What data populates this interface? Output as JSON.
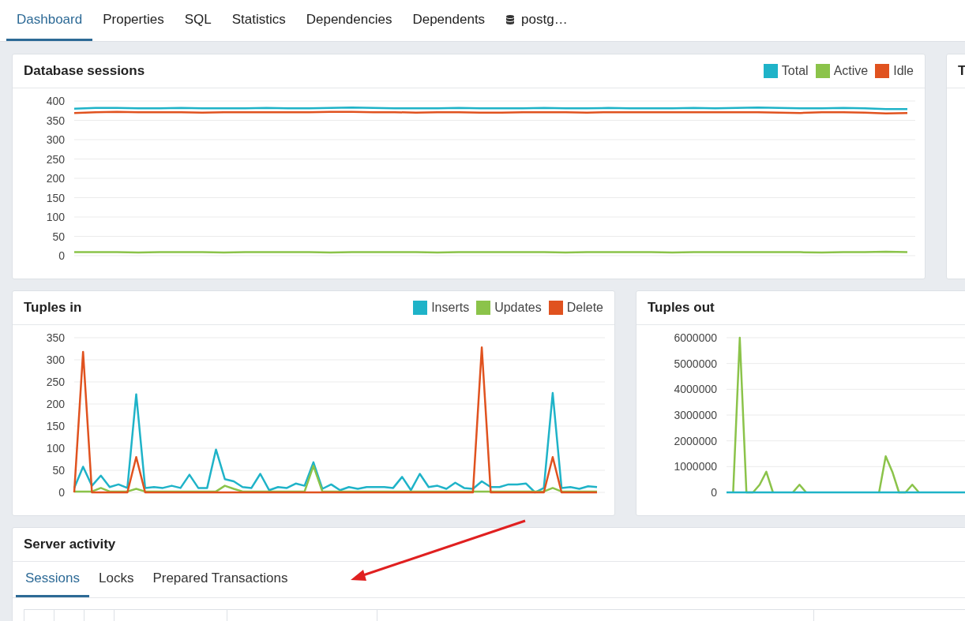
{
  "tabs": [
    {
      "label": "Dashboard",
      "selected": true,
      "kind": "text"
    },
    {
      "label": "Properties",
      "selected": false,
      "kind": "text"
    },
    {
      "label": "SQL",
      "selected": false,
      "kind": "text"
    },
    {
      "label": "Statistics",
      "selected": false,
      "kind": "text"
    },
    {
      "label": "Dependencies",
      "selected": false,
      "kind": "text"
    },
    {
      "label": "Dependents",
      "selected": false,
      "kind": "text"
    },
    {
      "label": "postg…",
      "selected": false,
      "kind": "database"
    }
  ],
  "sessions_panel": {
    "title": "Database sessions",
    "chart_data": {
      "type": "line",
      "grid": true,
      "ylim": [
        0,
        400
      ],
      "yticks": [
        0,
        50,
        100,
        150,
        200,
        250,
        300,
        350,
        400
      ],
      "series": [
        {
          "name": "Total",
          "color": "#1fb3c8",
          "values": [
            380,
            382,
            382,
            381,
            381,
            382,
            381,
            381,
            381,
            382,
            381,
            381,
            382,
            383,
            382,
            381,
            381,
            381,
            382,
            381,
            381,
            381,
            382,
            381,
            381,
            382,
            381,
            381,
            381,
            382,
            381,
            382,
            383,
            382,
            381,
            381,
            382,
            381,
            379,
            379
          ]
        },
        {
          "name": "Active",
          "color": "#8bc34a",
          "values": [
            9,
            9,
            9,
            8,
            9,
            9,
            9,
            8,
            9,
            9,
            9,
            9,
            8,
            9,
            9,
            9,
            9,
            8,
            9,
            9,
            9,
            9,
            9,
            8,
            9,
            9,
            9,
            9,
            8,
            9,
            9,
            9,
            9,
            9,
            9,
            8,
            9,
            9,
            10,
            9
          ]
        },
        {
          "name": "Idle",
          "color": "#e0521f",
          "values": [
            369,
            371,
            372,
            371,
            371,
            371,
            370,
            371,
            371,
            371,
            371,
            371,
            372,
            372,
            371,
            371,
            370,
            371,
            371,
            370,
            370,
            371,
            371,
            371,
            370,
            371,
            371,
            371,
            371,
            371,
            371,
            371,
            371,
            370,
            369,
            371,
            371,
            370,
            368,
            369
          ]
        }
      ]
    }
  },
  "side_panel": {
    "title": "T"
  },
  "tuples_in_panel": {
    "title": "Tuples in",
    "chart_data": {
      "type": "line",
      "grid": true,
      "ylim": [
        0,
        350
      ],
      "yticks": [
        0,
        50,
        100,
        150,
        200,
        250,
        300,
        350
      ],
      "series": [
        {
          "name": "Inserts",
          "color": "#1fb3c8",
          "values": [
            10,
            58,
            15,
            38,
            12,
            18,
            10,
            222,
            10,
            12,
            10,
            15,
            10,
            40,
            10,
            10,
            97,
            30,
            25,
            12,
            10,
            42,
            5,
            12,
            10,
            20,
            15,
            68,
            8,
            18,
            5,
            12,
            8,
            12,
            12,
            12,
            10,
            35,
            5,
            42,
            12,
            15,
            8,
            22,
            10,
            8,
            25,
            12,
            12,
            18,
            18,
            20,
            0,
            10,
            225,
            10,
            12,
            8,
            14,
            12
          ]
        },
        {
          "name": "Updates",
          "color": "#8bc34a",
          "values": [
            2,
            2,
            2,
            10,
            2,
            2,
            2,
            8,
            2,
            2,
            2,
            2,
            2,
            2,
            2,
            2,
            2,
            15,
            8,
            2,
            2,
            2,
            2,
            2,
            2,
            2,
            2,
            60,
            2,
            2,
            2,
            2,
            2,
            2,
            2,
            2,
            2,
            2,
            2,
            2,
            2,
            2,
            2,
            2,
            2,
            2,
            2,
            2,
            2,
            2,
            2,
            2,
            2,
            2,
            10,
            2,
            2,
            2,
            2,
            2
          ]
        },
        {
          "name": "Delete",
          "color": "#e0521f",
          "values": [
            0,
            318,
            0,
            0,
            0,
            0,
            0,
            80,
            0,
            0,
            0,
            0,
            0,
            0,
            0,
            0,
            0,
            0,
            0,
            0,
            0,
            0,
            0,
            0,
            0,
            0,
            0,
            0,
            0,
            0,
            0,
            0,
            0,
            0,
            0,
            0,
            0,
            0,
            0,
            0,
            0,
            0,
            0,
            0,
            0,
            0,
            328,
            0,
            0,
            0,
            0,
            0,
            0,
            0,
            80,
            0,
            0,
            0,
            0,
            0
          ]
        }
      ]
    }
  },
  "tuples_out_panel": {
    "title": "Tuples out",
    "chart_data": {
      "type": "line",
      "grid": true,
      "ylim": [
        0,
        6000000
      ],
      "yticks": [
        0,
        1000000,
        2000000,
        3000000,
        4000000,
        5000000,
        6000000
      ],
      "series": [
        {
          "color": "#8bc34a",
          "values": [
            null,
            0,
            6000000,
            0,
            0,
            300000,
            800000,
            0,
            null,
            null,
            0,
            300000,
            0,
            null,
            null,
            null,
            null,
            null,
            null,
            null,
            null,
            null,
            null,
            0,
            1400000,
            800000,
            0,
            0,
            300000,
            0,
            null,
            null,
            null,
            null,
            null,
            null,
            null
          ]
        },
        {
          "color": "#1fb3c8",
          "values": [
            0,
            0,
            0,
            0,
            0,
            0,
            0,
            0,
            0,
            0,
            0,
            0,
            0,
            0,
            0,
            0,
            0,
            0,
            0,
            0,
            0,
            0,
            0,
            0,
            0,
            0,
            0,
            0,
            0,
            0,
            0,
            0,
            0,
            0,
            0,
            0,
            0
          ]
        }
      ]
    }
  },
  "server_activity": {
    "title": "Server activity",
    "tabs": [
      {
        "label": "Sessions",
        "selected": true
      },
      {
        "label": "Locks",
        "selected": false
      },
      {
        "label": "Prepared Transactions",
        "selected": false
      }
    ]
  }
}
